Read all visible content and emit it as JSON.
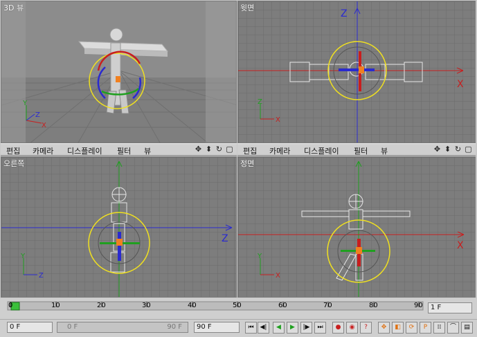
{
  "viewports": {
    "perspective": {
      "title": "3D 뷰"
    },
    "top": {
      "title": "윗면",
      "axis_x": "X",
      "axis_z": "Z"
    },
    "right": {
      "title": "오른쪽",
      "axis_z": "Z"
    },
    "front": {
      "title": "정면",
      "axis_x": "X"
    }
  },
  "menu": {
    "edit": "편집",
    "camera": "카메라",
    "display": "디스플레이",
    "filter": "필터",
    "view": "뷰"
  },
  "timeline": {
    "ticks": [
      "10",
      "20",
      "30",
      "40",
      "50",
      "60",
      "70",
      "80",
      "90"
    ],
    "start_tick": "0",
    "frame_display": "1 F"
  },
  "controls": {
    "current_frame": "0 F",
    "range_start": "0 F",
    "range_end": "90 F",
    "max_frame": "90 F"
  },
  "colors": {
    "grid_bg": "#7d7d7d",
    "axis_red": "#c81e1e",
    "axis_blue": "#2a2ad0",
    "axis_green": "#1fa01f",
    "select_yellow": "#f0e020"
  }
}
